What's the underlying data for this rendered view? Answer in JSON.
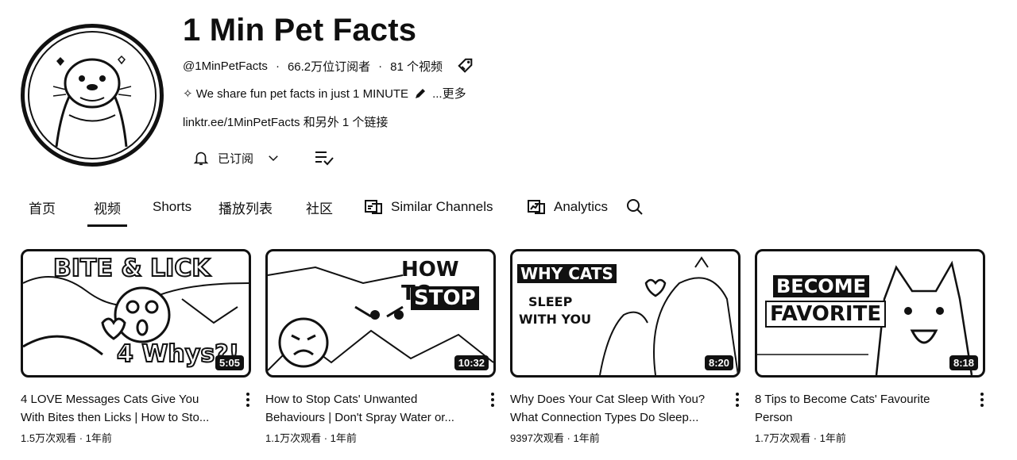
{
  "channel": {
    "name": "1 Min Pet Facts",
    "handle": "@1MinPetFacts",
    "sep1": "·",
    "subscribers": "66.2万位订阅者",
    "sep2": "·",
    "video_count": "81 个视频",
    "description": "✧ We share fun pet facts in just 1 MINUTE",
    "more": "...更多",
    "link_url": "linktr.ee/1MinPetFacts",
    "link_more": "和另外 1 个链接"
  },
  "actions": {
    "subscribed_label": "已订阅"
  },
  "tabs": [
    {
      "label": "首页"
    },
    {
      "label": "视频"
    },
    {
      "label": "Shorts"
    },
    {
      "label": "播放列表"
    },
    {
      "label": "社区"
    },
    {
      "label": "Similar Channels"
    },
    {
      "label": "Analytics"
    }
  ],
  "videos": [
    {
      "title_line1": "4 LOVE Messages Cats Give You",
      "title_line2": "With Bites then Licks | How to Sto...",
      "views": "1.5万次观看",
      "sep": "·",
      "age": "1年前",
      "duration": "5:05",
      "thumb_text": [
        "BITE & LICK",
        "4 Whys?!"
      ]
    },
    {
      "title_line1": "How to Stop Cats' Unwanted",
      "title_line2": "Behaviours | Don't Spray Water or...",
      "views": "1.1万次观看",
      "sep": "·",
      "age": "1年前",
      "duration": "10:32",
      "thumb_text": [
        "HOW TO",
        "STOP"
      ]
    },
    {
      "title_line1": "Why Does Your Cat Sleep With You?",
      "title_line2": "What Connection Types Do Sleep...",
      "views": "9397次观看",
      "sep": "·",
      "age": "1年前",
      "duration": "8:20",
      "thumb_text": [
        "WHY CATS",
        "SLEEP",
        "WITH YOU"
      ]
    },
    {
      "title_line1": "8 Tips to Become Cats' Favourite",
      "title_line2": "Person",
      "views": "1.7万次观看",
      "sep": "·",
      "age": "1年前",
      "duration": "8:18",
      "thumb_text": [
        "BECOME",
        "FAVORITE"
      ]
    }
  ],
  "icons": {
    "bell": "bell-icon",
    "chevron": "chevron-down-icon",
    "playlist_check": "playlist-check-icon",
    "search": "search-icon",
    "pencil": "pencil-icon",
    "tag": "tag-icon",
    "similar": "similar-channels-icon",
    "analytics": "analytics-icon"
  }
}
